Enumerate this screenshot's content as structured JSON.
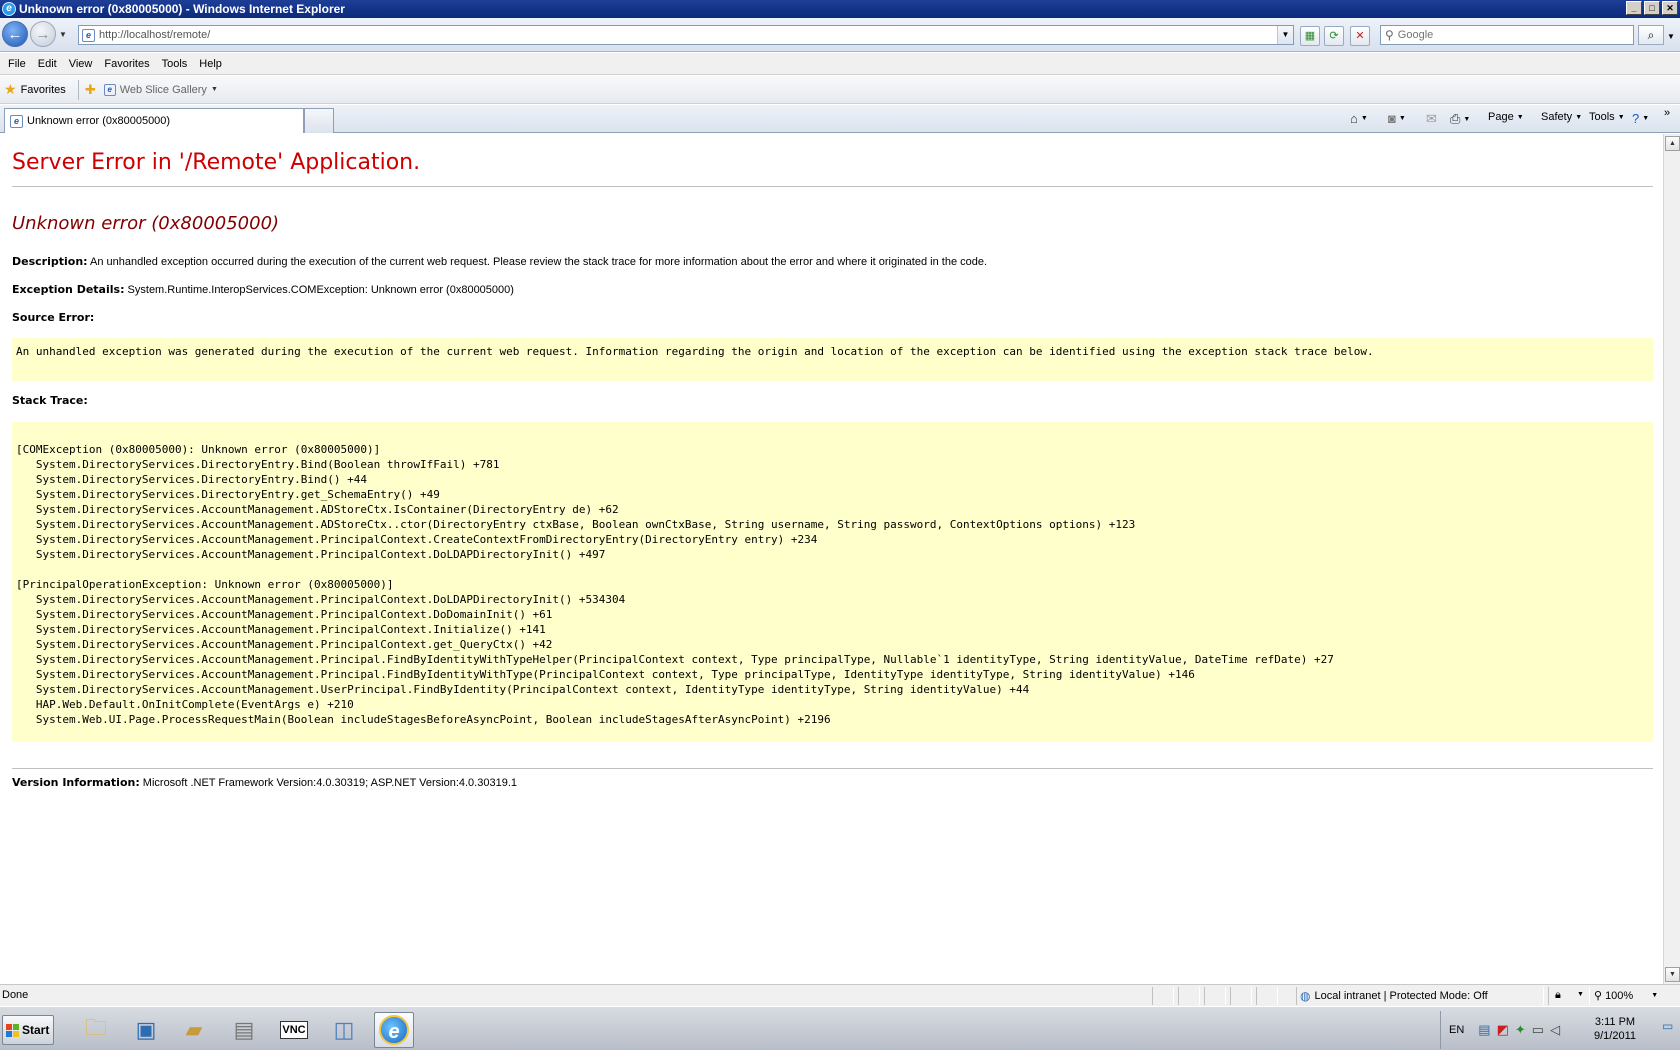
{
  "window": {
    "title": "Unknown error (0x80005000) - Windows Internet Explorer",
    "controls": {
      "minimize": "_",
      "maximize": "□",
      "close": "✕"
    }
  },
  "nav": {
    "url": "http://localhost/remote/",
    "search_placeholder": "Google"
  },
  "menu": [
    "File",
    "Edit",
    "View",
    "Favorites",
    "Tools",
    "Help"
  ],
  "favorites_bar": {
    "favorites_label": "Favorites",
    "web_slice_label": "Web Slice Gallery"
  },
  "tabs": [
    {
      "label": "Unknown error (0x80005000)"
    }
  ],
  "command_bar": {
    "page": "Page",
    "safety": "Safety",
    "tools": "Tools"
  },
  "error_page": {
    "heading": "Server Error in '/Remote' Application.",
    "error_title": "Unknown error (0x80005000)",
    "description_label": "Description:",
    "description": "An unhandled exception occurred during the execution of the current web request. Please review the stack trace for more information about the error and where it originated in the code.",
    "exception_label": "Exception Details:",
    "exception": "System.Runtime.InteropServices.COMException: Unknown error (0x80005000)",
    "source_error_label": "Source Error:",
    "source_error": "An unhandled exception was generated during the execution of the current web request. Information regarding the origin and location of the exception can be identified using the exception stack trace below.",
    "stack_trace_label": "Stack Trace:",
    "stack_trace": [
      "[COMException (0x80005000): Unknown error (0x80005000)]",
      "   System.DirectoryServices.DirectoryEntry.Bind(Boolean throwIfFail) +781",
      "   System.DirectoryServices.DirectoryEntry.Bind() +44",
      "   System.DirectoryServices.DirectoryEntry.get_SchemaEntry() +49",
      "   System.DirectoryServices.AccountManagement.ADStoreCtx.IsContainer(DirectoryEntry de) +62",
      "   System.DirectoryServices.AccountManagement.ADStoreCtx..ctor(DirectoryEntry ctxBase, Boolean ownCtxBase, String username, String password, ContextOptions options) +123",
      "   System.DirectoryServices.AccountManagement.PrincipalContext.CreateContextFromDirectoryEntry(DirectoryEntry entry) +234",
      "   System.DirectoryServices.AccountManagement.PrincipalContext.DoLDAPDirectoryInit() +497",
      "",
      "[PrincipalOperationException: Unknown error (0x80005000)]",
      "   System.DirectoryServices.AccountManagement.PrincipalContext.DoLDAPDirectoryInit() +534304",
      "   System.DirectoryServices.AccountManagement.PrincipalContext.DoDomainInit() +61",
      "   System.DirectoryServices.AccountManagement.PrincipalContext.Initialize() +141",
      "   System.DirectoryServices.AccountManagement.PrincipalContext.get_QueryCtx() +42",
      "   System.DirectoryServices.AccountManagement.Principal.FindByIdentityWithTypeHelper(PrincipalContext context, Type principalType, Nullable`1 identityType, String identityValue, DateTime refDate) +27",
      "   System.DirectoryServices.AccountManagement.Principal.FindByIdentityWithType(PrincipalContext context, Type principalType, IdentityType identityType, String identityValue) +146",
      "   System.DirectoryServices.AccountManagement.UserPrincipal.FindByIdentity(PrincipalContext context, IdentityType identityType, String identityValue) +44",
      "   HAP.Web.Default.OnInitComplete(EventArgs e) +210",
      "   System.Web.UI.Page.ProcessRequestMain(Boolean includeStagesBeforeAsyncPoint, Boolean includeStagesAfterAsyncPoint) +2196"
    ],
    "version_label": "Version Information:",
    "version": "Microsoft .NET Framework Version:4.0.30319; ASP.NET Version:4.0.30319.1"
  },
  "status_bar": {
    "status": "Done",
    "zone": "Local intranet | Protected Mode: Off",
    "zoom": "100%"
  },
  "taskbar": {
    "start_label": "Start",
    "vnc_label": "VNC",
    "language": "EN",
    "time": "3:11 PM",
    "date": "9/1/2011"
  },
  "colors": {
    "heading_red": "#cc0000",
    "error_title": "#800000",
    "code_background": "#ffffcc"
  }
}
